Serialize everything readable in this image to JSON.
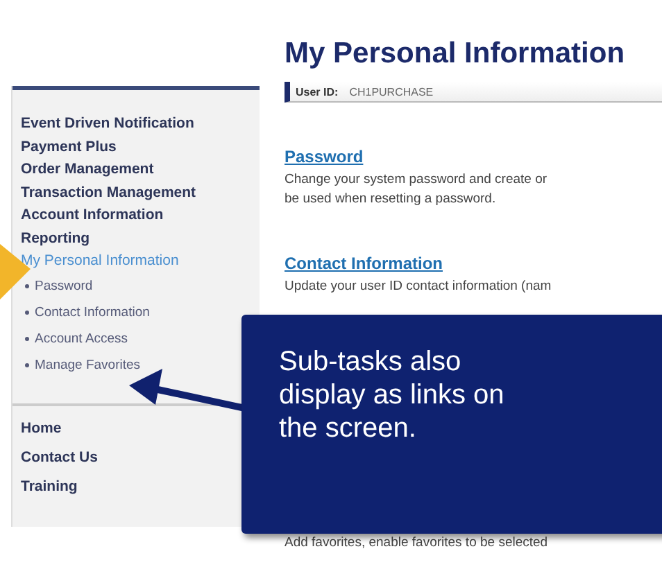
{
  "page_title": "My Personal Information",
  "user_id": {
    "label": "User ID:",
    "value": "CH1PURCHASE"
  },
  "sidebar": {
    "items": [
      {
        "label": "Event Driven Notification",
        "selected": false
      },
      {
        "label": "Payment Plus",
        "selected": false
      },
      {
        "label": "Order Management",
        "selected": false
      },
      {
        "label": "Transaction Management",
        "selected": false
      },
      {
        "label": "Account Information",
        "selected": false
      },
      {
        "label": "Reporting",
        "selected": false
      },
      {
        "label": "My Personal Information",
        "selected": true,
        "children": [
          {
            "label": "Password"
          },
          {
            "label": "Contact Information"
          },
          {
            "label": "Account Access"
          },
          {
            "label": "Manage Favorites"
          }
        ]
      }
    ],
    "bottom_items": [
      "Home",
      "Contact Us",
      "Training"
    ]
  },
  "sections": [
    {
      "title": "Password",
      "description": "Change your system password and create or\nbe used when resetting a password."
    },
    {
      "title": "Contact Information",
      "description": "Update your user ID contact information (nam"
    }
  ],
  "footer_text": "Add favorites, enable favorites to be selected",
  "callout": {
    "text": "Sub-tasks also display as links on the screen."
  }
}
